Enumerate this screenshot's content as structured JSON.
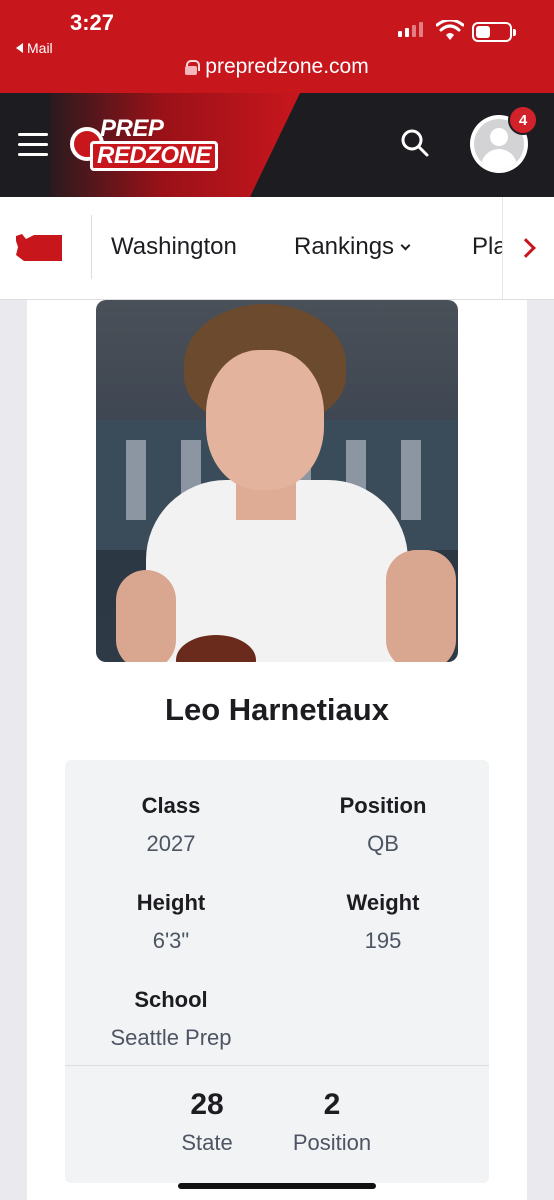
{
  "status_bar": {
    "time": "3:27",
    "back_app": "Mail",
    "url": "prepredzone.com"
  },
  "header": {
    "logo_line1": "PREP",
    "logo_line2": "REDZONE",
    "notification_count": "4"
  },
  "subnav": {
    "items": [
      "Washington",
      "Rankings",
      "Pla"
    ]
  },
  "player": {
    "name": "Leo Harnetiaux",
    "stats": {
      "class_label": "Class",
      "class_value": "2027",
      "position_label": "Position",
      "position_value": "QB",
      "height_label": "Height",
      "height_value": "6'3\"",
      "weight_label": "Weight",
      "weight_value": "195",
      "school_label": "School",
      "school_value": "Seattle Prep"
    },
    "rankings": {
      "state_rank": "28",
      "state_label": "State",
      "position_rank": "2",
      "position_label": "Position"
    }
  },
  "colors": {
    "brand_red": "#c8161d",
    "header_dark": "#1d1d21",
    "stats_bg": "#f2f3f5"
  }
}
